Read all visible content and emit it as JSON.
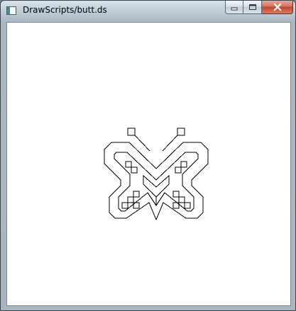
{
  "window": {
    "title": "DrawScripts/butt.ds",
    "icon": "app-window-icon",
    "close_color": "#c7442c"
  },
  "caption_buttons": [
    "minimize-icon",
    "maximize-icon",
    "close-icon"
  ],
  "drawing": {
    "subject": "butterfly",
    "stroke": "#000000",
    "background": "#ffffff"
  }
}
